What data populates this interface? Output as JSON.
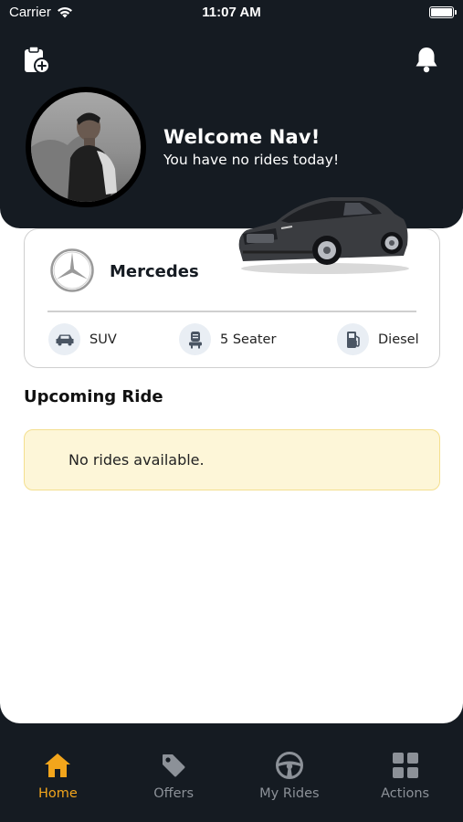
{
  "status_bar": {
    "carrier": "Carrier",
    "time": "11:07 AM"
  },
  "header": {
    "welcome_title": "Welcome Nav!",
    "welcome_subtitle": "You have no rides today!",
    "icons": [
      "clipboard-add-icon",
      "bell-icon"
    ]
  },
  "car": {
    "brand": "Mercedes",
    "features": [
      {
        "icon": "car-icon",
        "label": "SUV"
      },
      {
        "icon": "seat-icon",
        "label": "5 Seater"
      },
      {
        "icon": "fuel-pump-icon",
        "label": "Diesel"
      }
    ]
  },
  "upcoming": {
    "title": "Upcoming Ride",
    "empty_message": "No rides available."
  },
  "tabbar": {
    "tabs": [
      {
        "label": "Home",
        "icon": "home-icon",
        "active": true
      },
      {
        "label": "Offers",
        "icon": "tag-icon",
        "active": false
      },
      {
        "label": "My Rides",
        "icon": "steering-wheel-icon",
        "active": false
      },
      {
        "label": "Actions",
        "icon": "grid-icon",
        "active": false
      }
    ]
  },
  "colors": {
    "dark": "#151b22",
    "accent": "#f2a51c",
    "notice_bg": "#fdf6d8",
    "notice_border": "#f4df8f"
  }
}
